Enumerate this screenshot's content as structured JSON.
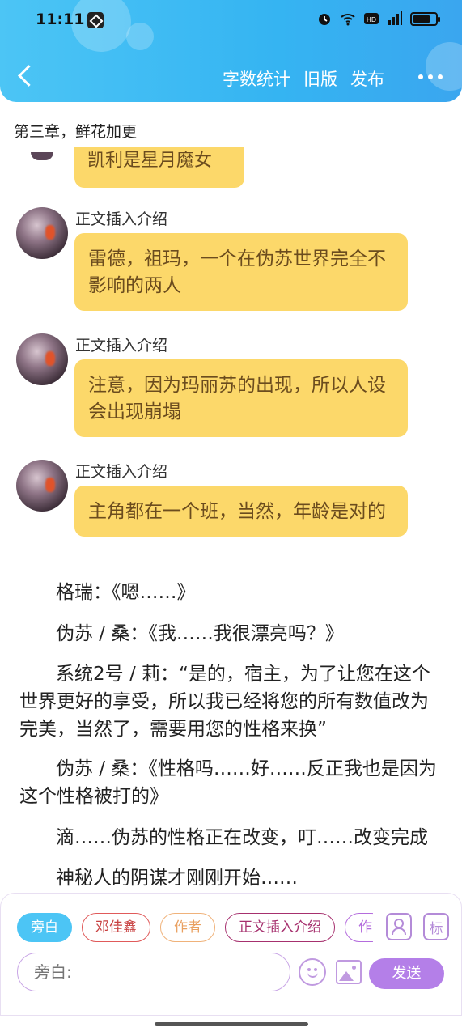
{
  "status_bar": {
    "time": "11:11"
  },
  "header": {
    "actions": [
      "字数统计",
      "旧版",
      "发布"
    ]
  },
  "chapter_title": "第三章，鲜花加更",
  "partial_bubble_text": "凯利是星月魔女",
  "messages": [
    {
      "sender": "正文插入介绍",
      "text": "雷德，祖玛，一个在伪苏世界完全不影响的两人"
    },
    {
      "sender": "正文插入介绍",
      "text": "注意，因为玛丽苏的出现，所以人设会出现崩塌"
    },
    {
      "sender": "正文插入介绍",
      "text": "主角都在一个班，当然，年龄是对的"
    }
  ],
  "narration": [
    "格瑞：《嗯……》",
    "伪苏 / 桑：《我……我很漂亮吗？》",
    "系统2号 / 莉：“是的，宿主，为了让您在这个世界更好的享受，所以我已经将您的所有数值改为完美，当然了，需要用您的性格来换”",
    "伪苏 / 桑：《性格吗……好……反正我也是因为这个性格被打的》",
    "滴……伪苏的性格正在改变，叮……改变完成",
    "神秘人的阴谋才刚刚开始……"
  ],
  "composer": {
    "roles": [
      "旁白",
      "邓佳鑫",
      "作者",
      "正文插入介绍",
      "作"
    ],
    "tool_mark": "标",
    "input_placeholder": "旁白:",
    "send_label": "发送"
  },
  "colors": {
    "header": "#35b4f2",
    "bubble": "#fcd86a",
    "send": "#b47fe8"
  }
}
